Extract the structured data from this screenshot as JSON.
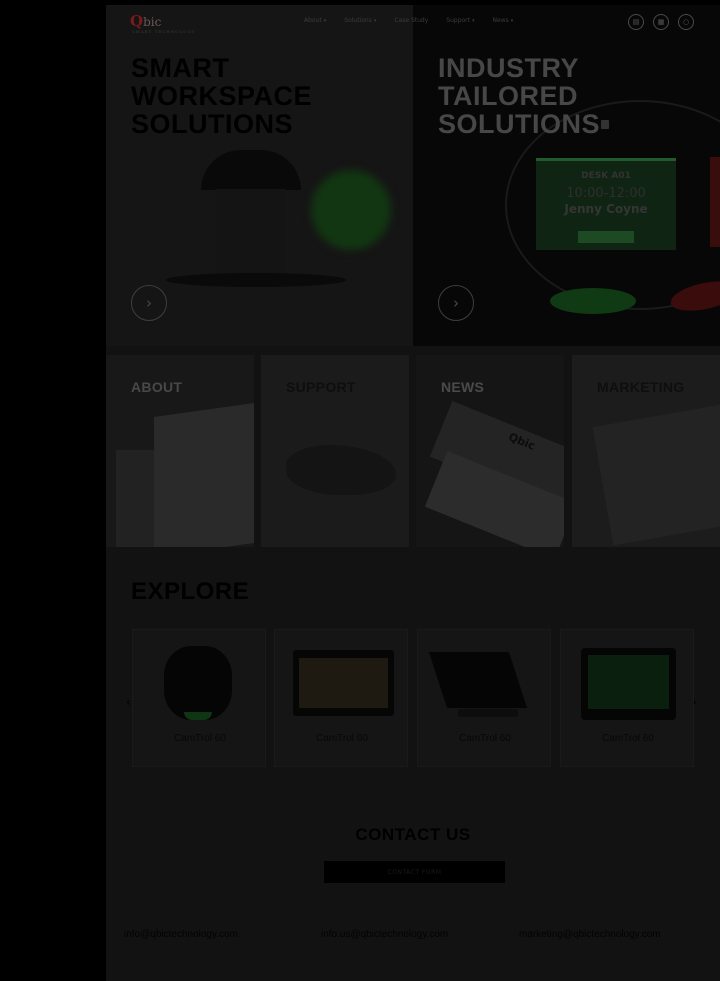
{
  "nav": {
    "logo": "bic",
    "logo_tagline": "SMART TECHNOLOGY",
    "items": [
      {
        "label": "About"
      },
      {
        "label": "Solutions"
      },
      {
        "label": "Case Study"
      },
      {
        "label": "Support"
      },
      {
        "label": "News"
      }
    ],
    "icons": [
      "chat-icon",
      "cart-icon",
      "user-icon"
    ]
  },
  "hero": {
    "left": {
      "title_lines": [
        "SMART",
        "WORKSPACE",
        "SOLUTIONS"
      ]
    },
    "right": {
      "title_lines": [
        "INDUSTRY",
        "TAILORED",
        "SOLUTIONS"
      ],
      "desk_label": "DESK A01",
      "desk_time": "10:00-12:00",
      "desk_name": "Jenny Coyne"
    }
  },
  "tiles": [
    {
      "label": "ABOUT"
    },
    {
      "label": "SUPPORT"
    },
    {
      "label": "NEWS"
    },
    {
      "label": "MARKETING"
    }
  ],
  "tile_news_overlay": "Qbic",
  "explore": {
    "title": "EXPLORE",
    "cards": [
      {
        "name": "CamTrol 60"
      },
      {
        "name": "CamTrol 60"
      },
      {
        "name": "CamTrol 60"
      },
      {
        "name": "CamTrol 60"
      }
    ]
  },
  "contact": {
    "title": "CONTACT US",
    "button": "CONTACT FORM",
    "emails": [
      {
        "value": "info@qbictechnology.com"
      },
      {
        "value": "info.us@qbictechnology.com"
      },
      {
        "value": "marketing@qbictechnology.com"
      }
    ]
  },
  "colors": {
    "accent_green": "#1d4a23",
    "accent_red": "#7a1a1a"
  }
}
